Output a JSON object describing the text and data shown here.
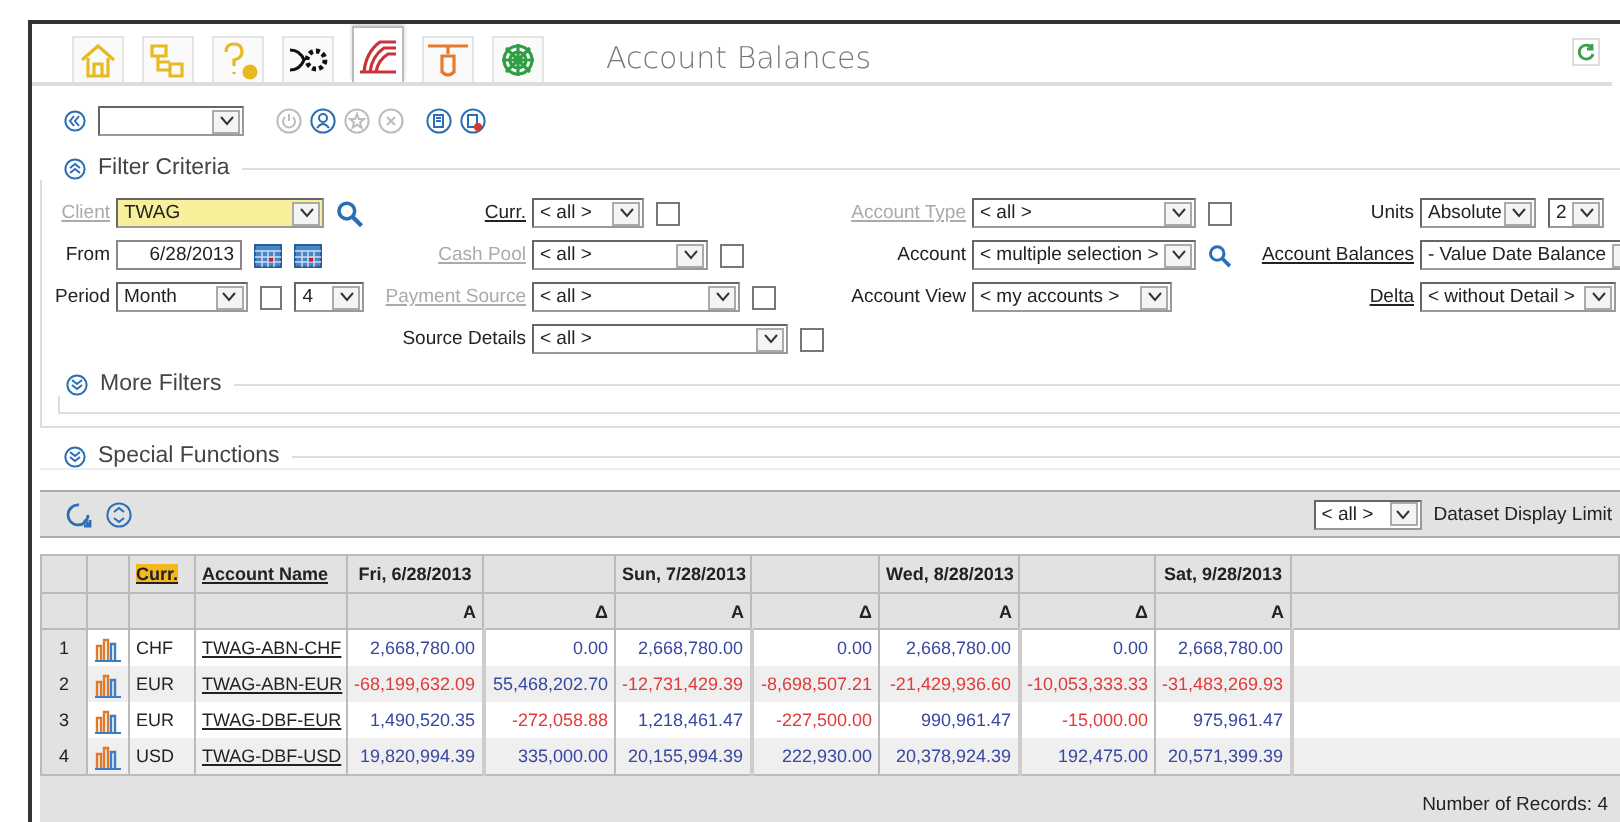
{
  "nav_tabs": [
    {
      "kind": "home",
      "selected": false
    },
    {
      "kind": "hierarchy",
      "selected": false
    },
    {
      "kind": "help",
      "selected": false
    },
    {
      "kind": "gears",
      "selected": false
    },
    {
      "kind": "waves",
      "selected": true
    },
    {
      "kind": "hand",
      "selected": false
    },
    {
      "kind": "web",
      "selected": false
    }
  ],
  "title": "Account Balances",
  "toolbar": {
    "buttons": [
      {
        "kind": "power",
        "disabled": true
      },
      {
        "kind": "person",
        "disabled": false
      },
      {
        "kind": "star",
        "disabled": true
      },
      {
        "kind": "close",
        "disabled": true
      },
      {
        "kind": "edit",
        "disabled": false
      },
      {
        "kind": "delete",
        "disabled": false
      }
    ]
  },
  "filter_criteria": {
    "title": "Filter Criteria",
    "expanded": true,
    "columns": [
      [
        {
          "label": "Client",
          "link": true,
          "disabled": true,
          "controls": [
            {
              "kind": "select",
              "value": "TWAG",
              "highlighted": true
            },
            {
              "kind": "search"
            }
          ]
        },
        {
          "label": "From",
          "link": false,
          "disabled": false,
          "controls": [
            {
              "kind": "date",
              "value": "6/28/2013"
            },
            {
              "kind": "calendar"
            },
            {
              "kind": "calendar"
            }
          ]
        },
        {
          "label": "Period",
          "link": false,
          "disabled": false,
          "controls": [
            {
              "kind": "select",
              "value": "Month",
              "highlighted": false
            },
            {
              "kind": "checkbox",
              "checked": false
            },
            {
              "kind": "select",
              "value": "4",
              "highlighted": false
            }
          ]
        }
      ],
      [
        {
          "label": "Curr.",
          "link": true,
          "disabled": false,
          "controls": [
            {
              "kind": "select",
              "value": "< all >",
              "highlighted": false
            },
            {
              "kind": "checkbox",
              "checked": false
            }
          ]
        },
        {
          "label": "Cash Pool",
          "link": true,
          "disabled": true,
          "controls": [
            {
              "kind": "select",
              "value": "< all >",
              "highlighted": false
            },
            {
              "kind": "checkbox",
              "checked": false
            }
          ]
        },
        {
          "label": "Payment Source",
          "link": true,
          "disabled": true,
          "controls": [
            {
              "kind": "select",
              "value": "< all >",
              "highlighted": false
            },
            {
              "kind": "checkbox",
              "checked": false
            }
          ]
        },
        {
          "label": "Source Details",
          "link": false,
          "disabled": false,
          "controls": [
            {
              "kind": "select",
              "value": "< all >",
              "highlighted": false
            },
            {
              "kind": "checkbox",
              "checked": false
            }
          ]
        }
      ],
      [
        {
          "label": "Account Type",
          "link": true,
          "disabled": true,
          "controls": [
            {
              "kind": "select",
              "value": "< all >",
              "highlighted": false
            },
            {
              "kind": "checkbox",
              "checked": false
            }
          ]
        },
        {
          "label": "Account",
          "link": false,
          "disabled": false,
          "controls": [
            {
              "kind": "select",
              "value": "< multiple selection >",
              "highlighted": false
            },
            {
              "kind": "search"
            }
          ]
        },
        {
          "label": "Account View",
          "link": false,
          "disabled": false,
          "controls": [
            {
              "kind": "select",
              "value": "< my accounts >",
              "highlighted": false
            }
          ]
        }
      ],
      [
        {
          "label": "Units",
          "link": false,
          "disabled": false,
          "controls": [
            {
              "kind": "select",
              "value": "Absolute",
              "highlighted": false
            },
            {
              "kind": "select",
              "value": "2",
              "highlighted": false
            }
          ]
        },
        {
          "label": "Account Balances",
          "link": true,
          "disabled": false,
          "controls": [
            {
              "kind": "select",
              "value": "- Value Date Balance",
              "highlighted": false
            }
          ]
        },
        {
          "label": "Delta",
          "link": true,
          "disabled": false,
          "controls": [
            {
              "kind": "select",
              "value": "< without Detail >",
              "highlighted": false
            }
          ]
        }
      ]
    ],
    "more_filters": {
      "title": "More Filters",
      "expanded": false
    }
  },
  "special_functions": {
    "title": "Special Functions",
    "expanded": false
  },
  "grid_toolbar": {
    "limit_value": "< all >",
    "limit_label": "Dataset Display Limit"
  },
  "table": {
    "header_top": [
      {
        "text": "Curr.",
        "kind": "link",
        "highlighted": true
      },
      {
        "text": "Account Name",
        "kind": "link",
        "highlighted": false
      },
      {
        "text": "Fri, 6/28/2013",
        "kind": "text"
      },
      {
        "kind": "blank"
      },
      {
        "text": "Sun, 7/28/2013",
        "kind": "text"
      },
      {
        "kind": "blank"
      },
      {
        "text": "Wed, 8/28/2013",
        "kind": "text"
      },
      {
        "kind": "blank"
      },
      {
        "text": "Sat, 9/28/2013",
        "kind": "text"
      }
    ],
    "header_sub": [
      "A",
      "Δ",
      "A",
      "Δ",
      "A",
      "Δ",
      "A"
    ],
    "rows": [
      {
        "index": "1",
        "currency": "CHF",
        "account": "TWAG-ABN-CHF",
        "values": [
          {
            "text": "2,668,780.00",
            "negative": false
          },
          {
            "text": "0.00",
            "negative": false
          },
          {
            "text": "2,668,780.00",
            "negative": false
          },
          {
            "text": "0.00",
            "negative": false
          },
          {
            "text": "2,668,780.00",
            "negative": false
          },
          {
            "text": "0.00",
            "negative": false
          },
          {
            "text": "2,668,780.00",
            "negative": false
          }
        ]
      },
      {
        "index": "2",
        "currency": "EUR",
        "account": "TWAG-ABN-EUR",
        "values": [
          {
            "text": "-68,199,632.09",
            "negative": true
          },
          {
            "text": "55,468,202.70",
            "negative": false
          },
          {
            "text": "-12,731,429.39",
            "negative": true
          },
          {
            "text": "-8,698,507.21",
            "negative": true
          },
          {
            "text": "-21,429,936.60",
            "negative": true
          },
          {
            "text": "-10,053,333.33",
            "negative": true
          },
          {
            "text": "-31,483,269.93",
            "negative": true
          }
        ]
      },
      {
        "index": "3",
        "currency": "EUR",
        "account": "TWAG-DBF-EUR",
        "values": [
          {
            "text": "1,490,520.35",
            "negative": false
          },
          {
            "text": "-272,058.88",
            "negative": true
          },
          {
            "text": "1,218,461.47",
            "negative": false
          },
          {
            "text": "-227,500.00",
            "negative": true
          },
          {
            "text": "990,961.47",
            "negative": false
          },
          {
            "text": "-15,000.00",
            "negative": true
          },
          {
            "text": "975,961.47",
            "negative": false
          }
        ]
      },
      {
        "index": "4",
        "currency": "USD",
        "account": "TWAG-DBF-USD",
        "values": [
          {
            "text": "19,820,994.39",
            "negative": false
          },
          {
            "text": "335,000.00",
            "negative": false
          },
          {
            "text": "20,155,994.39",
            "negative": false
          },
          {
            "text": "222,930.00",
            "negative": false
          },
          {
            "text": "20,378,924.39",
            "negative": false
          },
          {
            "text": "192,475.00",
            "negative": false
          },
          {
            "text": "20,571,399.39",
            "negative": false
          }
        ]
      }
    ],
    "footer": "Number of Records: 4"
  }
}
